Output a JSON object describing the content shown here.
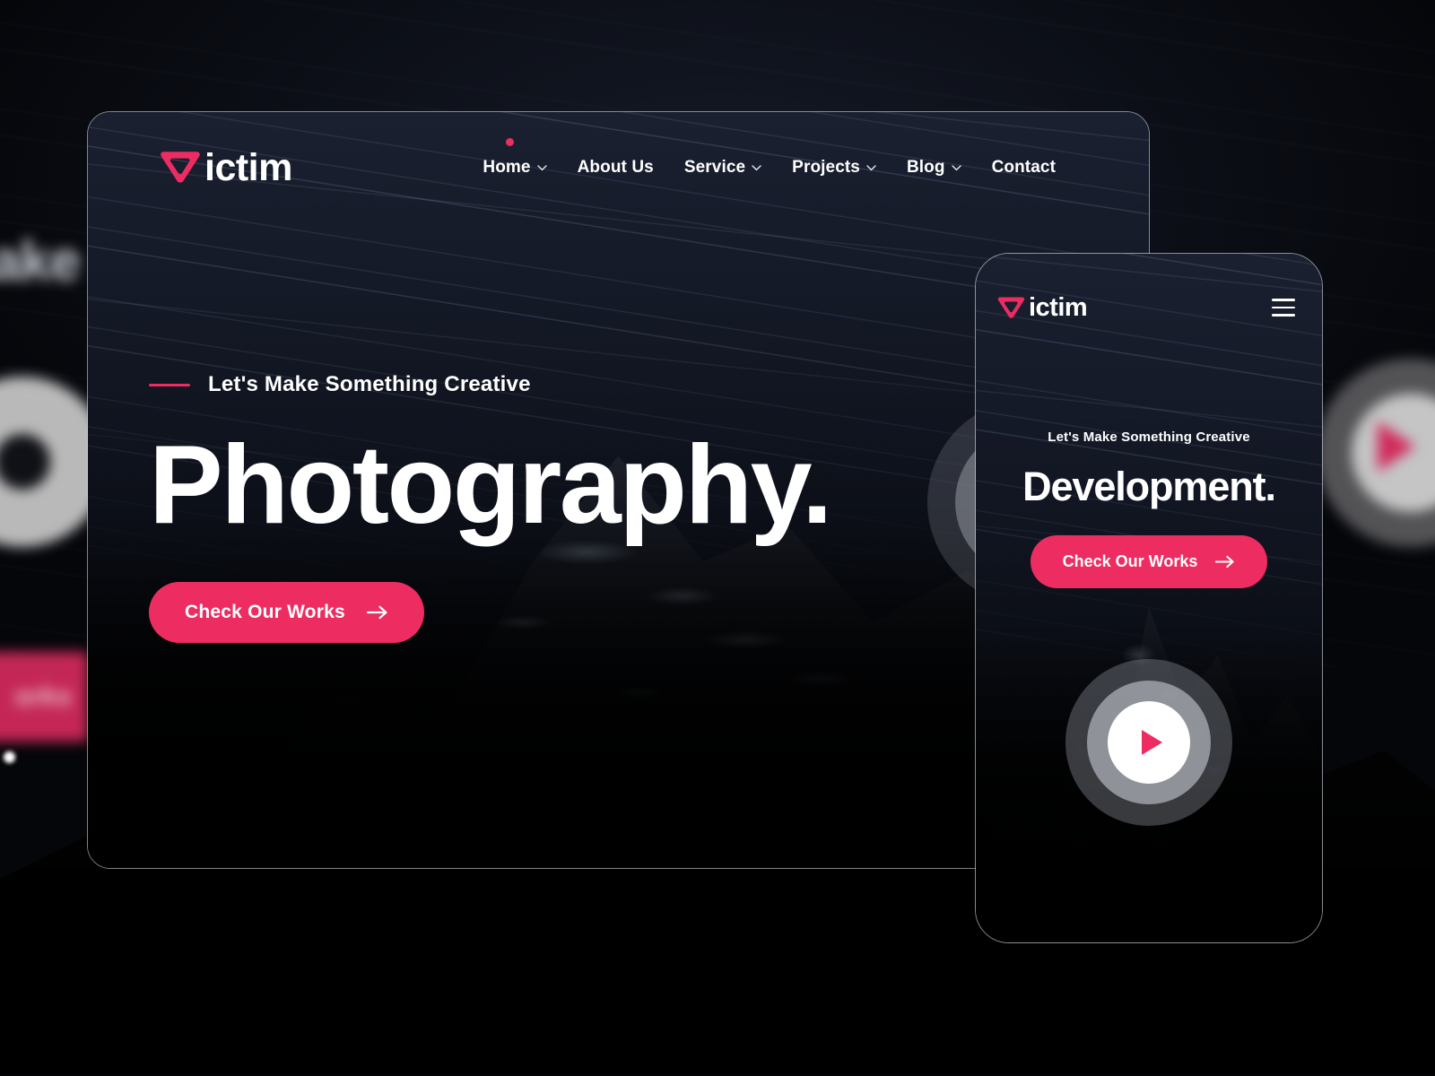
{
  "brand": {
    "name": "ictim",
    "full_name": "Victim",
    "accent_color": "#ed2c62",
    "logo_icon": "victim-v-logo-icon"
  },
  "desktop": {
    "nav": {
      "items": [
        {
          "label": "Home",
          "has_dropdown": true,
          "active": true
        },
        {
          "label": "About Us",
          "has_dropdown": false,
          "active": false
        },
        {
          "label": "Service",
          "has_dropdown": true,
          "active": false
        },
        {
          "label": "Projects",
          "has_dropdown": true,
          "active": false
        },
        {
          "label": "Blog",
          "has_dropdown": true,
          "active": false
        },
        {
          "label": "Contact",
          "has_dropdown": false,
          "active": false
        }
      ]
    },
    "hero": {
      "eyebrow": "Let's Make Something Creative",
      "title": "Photography.",
      "cta_label": "Check Our Works",
      "cta_icon": "arrow-right-icon"
    },
    "play_button_icon": "play-circle-icon"
  },
  "phone": {
    "menu_icon": "hamburger-menu-icon",
    "hero": {
      "eyebrow": "Let's Make Something Creative",
      "title": "Development.",
      "cta_label": "Check Our Works",
      "cta_icon": "arrow-right-icon"
    },
    "play_button_icon": "play-circle-icon"
  },
  "backdrop": {
    "ghost_text": "Make",
    "ghost_button_text": "orks"
  }
}
